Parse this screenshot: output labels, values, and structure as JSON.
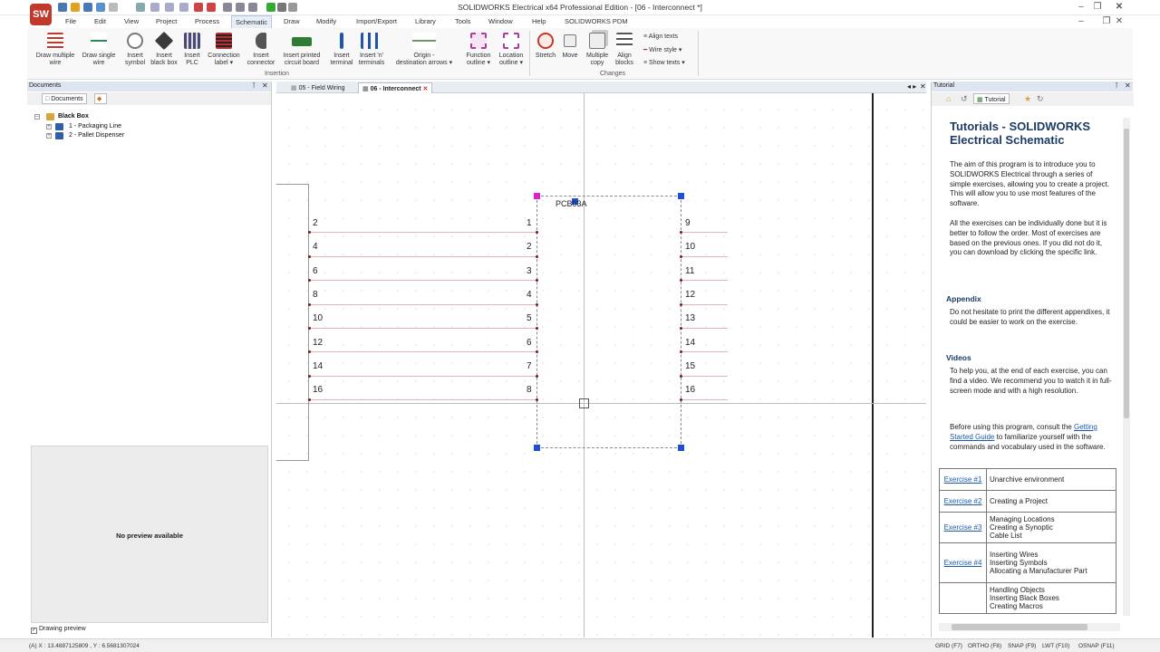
{
  "app": {
    "title": "SOLIDWORKS Electrical x64 Professional Edition - [06 - Interconnect *]",
    "logo_text": "SW"
  },
  "menu": {
    "items": [
      "File",
      "Edit",
      "View",
      "Project",
      "Process",
      "Schematic",
      "Draw",
      "Modify",
      "Import/Export",
      "Library",
      "Tools",
      "Window",
      "Help",
      "SOLIDWORKS PDM"
    ],
    "active": "Schematic"
  },
  "ribbon": {
    "insertion": {
      "group_label": "Insertion",
      "buttons": [
        {
          "label1": "Draw multiple",
          "label2": "wire",
          "icon": "multi-wire-icon",
          "color": "#c0392b"
        },
        {
          "label1": "Draw single",
          "label2": "wire",
          "icon": "single-wire-icon",
          "color": "#2e8b57"
        },
        {
          "label1": "Insert",
          "label2": "symbol",
          "icon": "symbol-icon",
          "color": "#7a7a7a"
        },
        {
          "label1": "Insert",
          "label2": "black box",
          "icon": "black-box-icon",
          "color": "#3a3a3a"
        },
        {
          "label1": "Insert",
          "label2": "PLC",
          "icon": "plc-icon",
          "color": "#4a4a7a"
        },
        {
          "label1": "Connection",
          "label2": "label",
          "icon": "connection-label-icon",
          "color": "#a33"
        },
        {
          "label1": "Insert",
          "label2": "connector",
          "icon": "connector-icon",
          "color": "#555"
        },
        {
          "label1": "Insert printed",
          "label2": "circuit board",
          "icon": "pcb-icon",
          "color": "#2f7d32"
        },
        {
          "label1": "Insert",
          "label2": "terminal",
          "icon": "terminal-icon",
          "color": "#2255aa"
        },
        {
          "label1": "Insert 'n'",
          "label2": "terminals",
          "icon": "n-terminals-icon",
          "color": "#2255aa"
        },
        {
          "label1": "Origin -",
          "label2": "destination arrows",
          "icon": "origin-arrows-icon",
          "color": "#6a9a6a"
        },
        {
          "label1": "Function",
          "label2": "outline",
          "icon": "function-outline-icon",
          "color": "#b03c9c"
        },
        {
          "label1": "Location",
          "label2": "outline",
          "icon": "location-outline-icon",
          "color": "#b03c9c"
        }
      ]
    },
    "changes": {
      "group_label": "Changes",
      "buttons": [
        {
          "label1": "Stretch",
          "label2": "",
          "icon": "stretch-icon",
          "color": "#c0392b"
        },
        {
          "label1": "Move",
          "label2": "",
          "icon": "move-icon",
          "color": "#777"
        },
        {
          "label1": "Multiple",
          "label2": "copy",
          "icon": "multiple-copy-icon",
          "color": "#777"
        },
        {
          "label1": "Align",
          "label2": "blocks",
          "icon": "align-blocks-icon",
          "color": "#555"
        }
      ],
      "small": [
        "Align texts",
        "Wire style",
        "Show texts"
      ]
    }
  },
  "documents": {
    "panel_title": "Documents",
    "tab_label": "Documents",
    "root": "Black Box",
    "children": [
      "1 - Packaging Line",
      "2 - Pallet Dispenser"
    ],
    "preview_text": "No preview available",
    "drawing_preview_label": "Drawing preview"
  },
  "canvas": {
    "tabs": [
      {
        "label": "05 - Field Wiring",
        "active": false
      },
      {
        "label": "06 - Interconnect",
        "active": true
      }
    ],
    "component_tag": "PCB03A",
    "left_numbers": [
      "2",
      "4",
      "6",
      "8",
      "10",
      "12",
      "14",
      "16"
    ],
    "inner_numbers": [
      "1",
      "2",
      "3",
      "4",
      "5",
      "6",
      "7",
      "8"
    ],
    "right_numbers": [
      "9",
      "10",
      "11",
      "12",
      "13",
      "14",
      "15",
      "16"
    ]
  },
  "tutorial": {
    "panel_title": "Tutorial",
    "tab_label": "Tutorial",
    "heading": "Tutorials - SOLIDWORKS Electrical Schematic",
    "intro": "The aim of this program is to introduce you to SOLIDWORKS Electrical through a series of simple exercises, allowing you to create a project. This will allow you to use most features of the software.",
    "intro2": "All the exercises can be individually done but it is better to follow the order. Most of exercises are based on the previous ones. If you did not do it, you can download by clicking the specific link.",
    "appendix_title": "Appendix",
    "appendix_text": "Do not hesitate to print the different appendixes, it could be easier to work on the exercise.",
    "videos_title": "Videos",
    "videos_text": "To help you, at the end of each exercise, you can find a video. We recommend you to watch it in full-screen mode and with a high resolution.",
    "consult_pre": "Before using this program, consult the",
    "consult_link": "Getting Started Guide",
    "consult_post": "to familiarize yourself with the commands and vocabulary used in the software.",
    "exercises": [
      {
        "num": "Exercise #1",
        "desc": [
          "Unarchive environment"
        ]
      },
      {
        "num": "Exercise #2",
        "desc": [
          "Creating a Project"
        ]
      },
      {
        "num": "Exercise #3",
        "desc": [
          "Managing Locations",
          "Creating a Synoptic",
          "Cable List"
        ]
      },
      {
        "num": "Exercise #4",
        "desc": [
          "Inserting Wires",
          "Inserting Symbols",
          "Allocating a Manufacturer Part"
        ]
      },
      {
        "num": "",
        "desc": [
          "Handling Objects",
          "Inserting Black Boxes",
          "Creating Macros"
        ]
      }
    ]
  },
  "status": {
    "coords": "(A) X : 13.4887125809 , Y : 6.5681307024",
    "toggles": [
      "GRID (F7)",
      "ORTHO (F8)",
      "SNAP (F9)",
      "LWT (F10)",
      "OSNAP (F11)"
    ]
  }
}
